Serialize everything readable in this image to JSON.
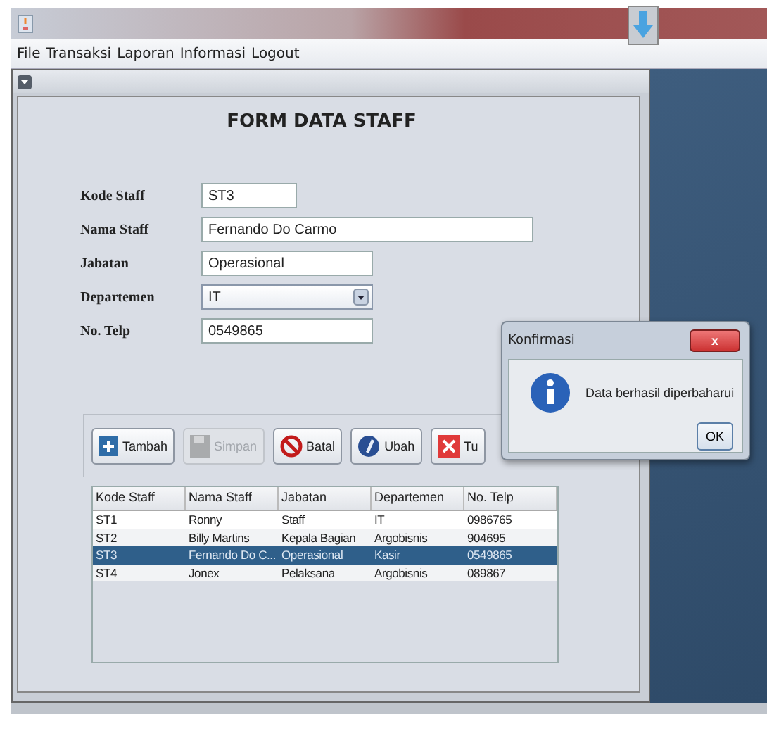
{
  "menu": [
    "File",
    "Transaksi",
    "Laporan",
    "Informasi",
    "Logout"
  ],
  "form": {
    "title": "FORM DATA STAFF",
    "fields": [
      {
        "label": "Kode Staff",
        "kind": "text",
        "value": "ST3"
      },
      {
        "label": "Nama Staff",
        "kind": "text",
        "value": "Fernando Do Carmo"
      },
      {
        "label": "Jabatan",
        "kind": "text",
        "value": "Operasional"
      },
      {
        "label": "Departemen",
        "kind": "combo",
        "value": "IT"
      },
      {
        "label": "No. Telp",
        "kind": "text",
        "value": "0549865"
      }
    ]
  },
  "buttons": [
    {
      "label": "Tambah",
      "disabled": false
    },
    {
      "label": "Simpan",
      "disabled": true
    },
    {
      "label": "Batal",
      "disabled": false
    },
    {
      "label": "Ubah",
      "disabled": false
    },
    {
      "label": "Tu",
      "disabled": false
    }
  ],
  "table": {
    "columns": [
      "Kode Staff",
      "Nama Staff",
      "Jabatan",
      "Departemen",
      "No. Telp"
    ],
    "rows": [
      {
        "cells": [
          "ST1",
          "Ronny",
          "Staff",
          "IT",
          "0986765"
        ],
        "selected": false
      },
      {
        "cells": [
          "ST2",
          "Billy Martins",
          "Kepala Bagian",
          "Argobisnis",
          "904695"
        ],
        "selected": false
      },
      {
        "cells": [
          "ST3",
          "Fernando Do C...",
          "Operasional",
          "Kasir",
          "0549865"
        ],
        "selected": true
      },
      {
        "cells": [
          "ST4",
          "Jonex",
          "Pelaksana",
          "Argobisnis",
          "089867"
        ],
        "selected": false
      }
    ]
  },
  "dialog": {
    "title": "Konfirmasi",
    "message": "Data berhasil diperbaharui",
    "button": "OK",
    "close": "x"
  }
}
